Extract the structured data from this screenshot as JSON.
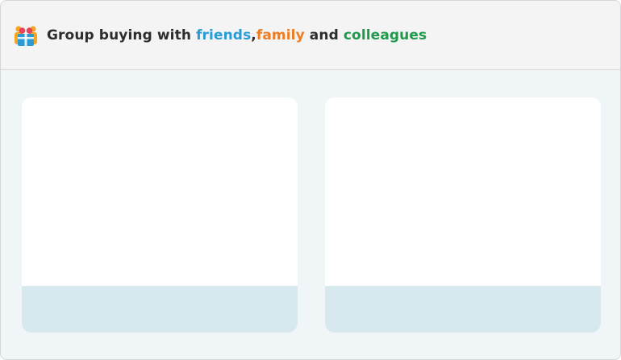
{
  "header": {
    "title_prefix": "Group buying with ",
    "word_friends": "friends",
    "separator": ",",
    "word_family": "family",
    "word_and": " and ",
    "word_colleagues": "colleagues",
    "logo_icon": "group-gift-icon"
  },
  "colors": {
    "friends": "#2a9bd4",
    "family": "#ec7d25",
    "colleagues": "#1f9a4b"
  },
  "cards": [
    {
      "name": "left-card"
    },
    {
      "name": "right-card"
    }
  ]
}
